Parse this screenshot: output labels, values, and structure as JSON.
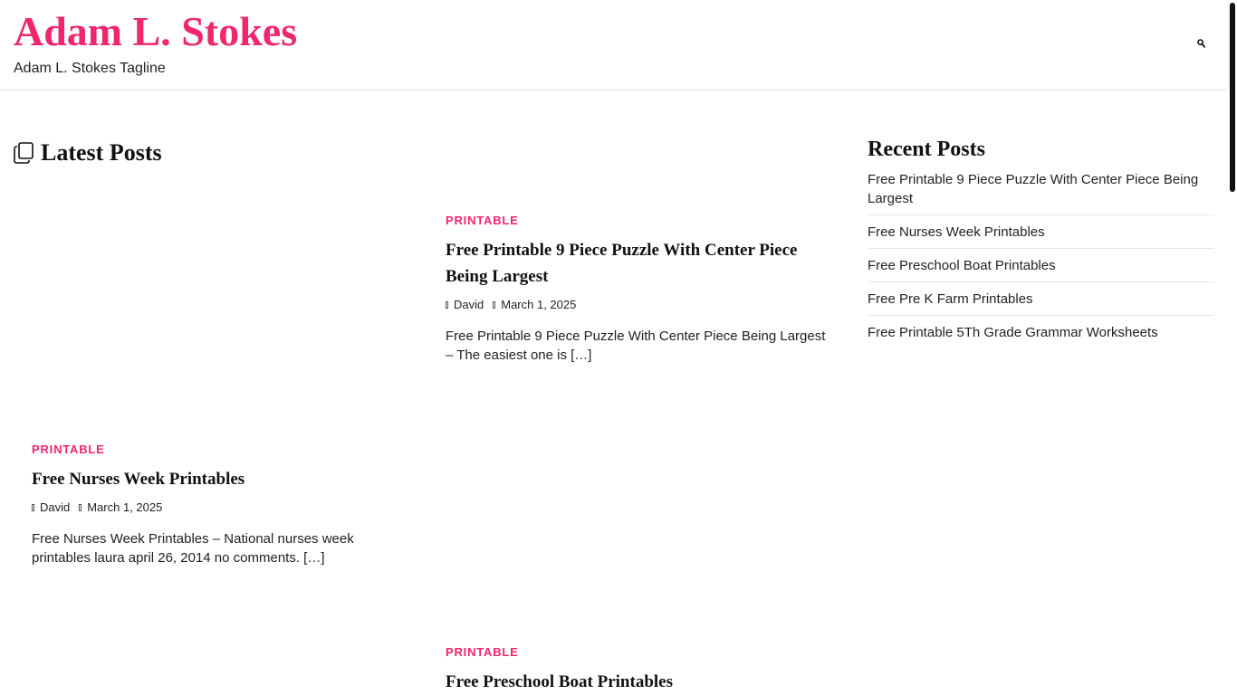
{
  "theme": {
    "accent": "#f0266f",
    "text": "#222222",
    "heading": "#111111"
  },
  "header": {
    "site_title": "Adam L. Stokes",
    "tagline": "Adam L. Stokes Tagline",
    "search_icon": "search-icon"
  },
  "main": {
    "section_title": "Latest Posts",
    "section_icon": "copy-icon",
    "posts": [
      {
        "category": "PRINTABLE",
        "title": "Free Printable 9 Piece Puzzle With Center Piece Being Largest",
        "author": "David",
        "date": "March 1, 2025",
        "excerpt": "Free Printable 9 Piece Puzzle With Center Piece Being Largest – The easiest one is […]"
      },
      {
        "category": "PRINTABLE",
        "title": "Free Nurses Week Printables",
        "author": "David",
        "date": "March 1, 2025",
        "excerpt": "Free Nurses Week Printables – National nurses week printables laura april 26, 2014 no comments. […]"
      },
      {
        "category": "PRINTABLE",
        "title": "Free Preschool Boat Printables"
      }
    ]
  },
  "sidebar": {
    "title": "Recent Posts",
    "items": [
      "Free Printable 9 Piece Puzzle With Center Piece Being Largest",
      "Free Nurses Week Printables",
      "Free Preschool Boat Printables",
      "Free Pre K Farm Printables",
      "Free Printable 5Th Grade Grammar Worksheets"
    ]
  }
}
